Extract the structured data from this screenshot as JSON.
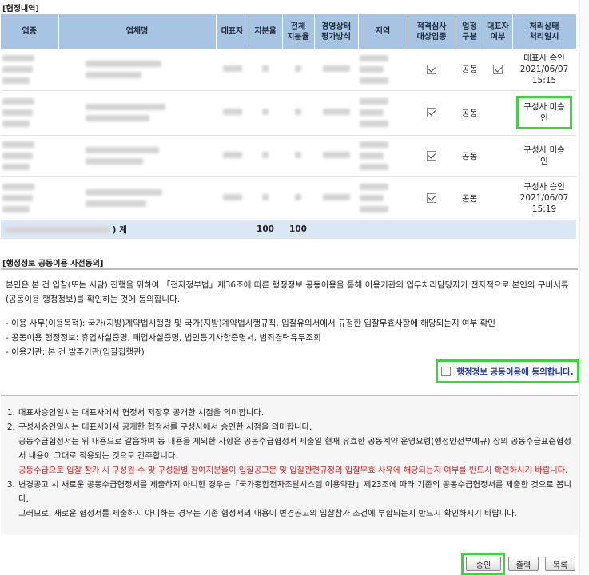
{
  "sections": {
    "contract_title": "[협정내역]",
    "consent_title": "[행정정보 공동이용 사전동의]"
  },
  "table": {
    "headers": [
      "업종",
      "업체명",
      "대표자",
      "지분율",
      "전체\n지분율",
      "경영상태\n평가방식",
      "지역",
      "적격심사\n대상업종",
      "업정\n구분",
      "대표자\n여부",
      "처리상태\n처리일시"
    ],
    "rows": [
      {
        "qualified": true,
        "type": "공동",
        "rep": true,
        "status": "대표사 승인\n2021/06/07\n15:15"
      },
      {
        "qualified": true,
        "type": "공동",
        "rep": false,
        "status": "구성사 미승\n인"
      },
      {
        "qualified": true,
        "type": "공동",
        "rep": false,
        "status": "구성사 미승\n인"
      },
      {
        "qualified": true,
        "type": "공동",
        "rep": false,
        "status": "구성사 승인\n2021/06/07\n15:19"
      }
    ],
    "total": {
      "label": ") 계",
      "share": "100",
      "total_share": "100"
    }
  },
  "consent": {
    "paragraph": "본인은 본 건 입찰(또는 시담) 진행을 위하여 「전자정부법」제36조에 따른 행정정보 공동이용을 통해 이용기관의 업무처리담당자가 전자적으로 본인의 구비서류(공동이용 행정정보)를 확인하는 것에 동의합니다.",
    "items": [
      "- 이용 사무(이용목적): 국가(지방)계약법시행령 및 국가(지방)계약법시행규칙, 입찰유의서에서 규정한 입찰무효사항에 해당되는지 여부 확인",
      "- 공동이용 행정정보: 휴업사실증명, 폐업사실증명, 법인등기사항증명서, 범죄경력유무조회",
      "- 이용기관: 본 건 발주기관(입찰집행관)"
    ],
    "agree_label": "행정정보 공동이용에 동의합니다.",
    "agree_checked": false
  },
  "notice": {
    "item1": "대표사승인일시는 대표사에서 협정서 저장후 공개한 시점을 의미합니다.",
    "item2_line1": "구성사승인일시는 대표사에서 공개한 협정서를 구성사에서 승인한 시점을 의미합니다.",
    "item2_line2": "공동수급협정서는 위 내용으로 갈음하며 동 내용을 제외한 사항은 공동수급협정서 제출일 현재 유효한 공동계약 운영요령(행정안전부예규) 상의 공동수급표준협정서 내용이 그대로 적용되는 것으로 간주합니다.",
    "item2_red": "공동수급으로 입찰 참가 시 구성원 수 및 구성원별 참여지분율이 입찰공고문 및 입찰관련규정의 입찰무효 사유에 해당되는지 여부를 반드시 확인하시기 바랍니다.",
    "item3_line1": "변경공고 시 새로운 공동수급협정서를 제출하지 아니한 경우는「국가종합전자조달시스템 이용약관」제23조에 따라 기존의 공동수급협정서를 제출한 것으로 봅니다.",
    "item3_line2": "그러므로, 새로운 협정서를 제출하지 아니하는 경우는 기존 협정서의 내용이 변경공고의 입찰참가 조건에 부합되는지 반드시 확인하시기 바랍니다."
  },
  "buttons": {
    "approve": "승인",
    "print": "출력",
    "list": "목록"
  },
  "colors": {
    "header_bg": "#a7c4e2",
    "total_bg": "#dbe7f5",
    "highlight": "#3cd43c",
    "agree_text": "#1838c8",
    "warning": "#e02020"
  }
}
